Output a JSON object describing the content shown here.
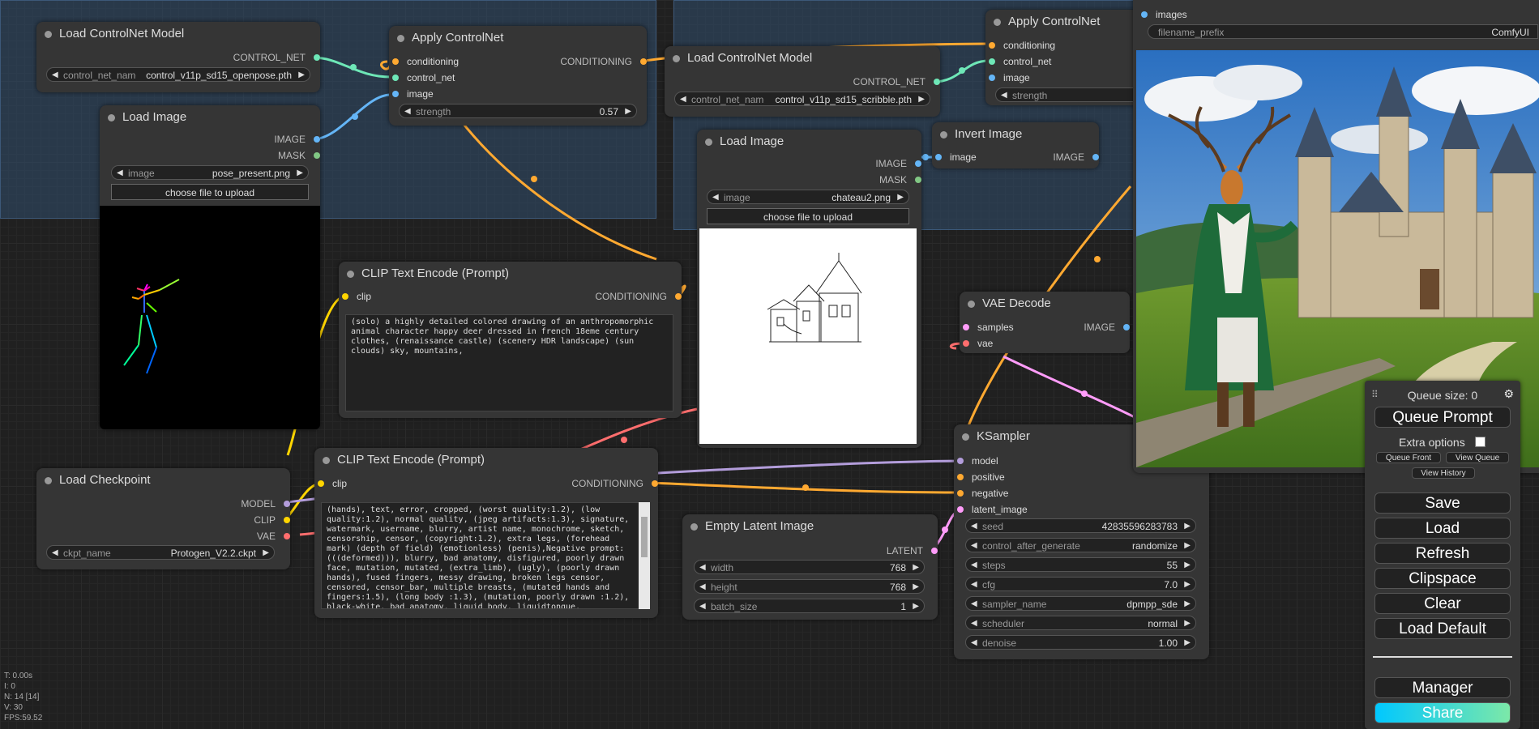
{
  "nodes": {
    "load_cn_1": {
      "title": "Load ControlNet Model",
      "out": "CONTROL_NET",
      "w_name": "control_net_name",
      "w_val": "control_v11p_sd15_openpose.pth"
    },
    "apply_cn_1": {
      "title": "Apply ControlNet",
      "in1": "conditioning",
      "in2": "control_net",
      "in3": "image",
      "out": "CONDITIONING",
      "w_name": "strength",
      "w_val": "0.57"
    },
    "load_image_1": {
      "title": "Load Image",
      "out1": "IMAGE",
      "out2": "MASK",
      "w_name": "image",
      "w_val": "pose_present.png",
      "upload": "choose file to upload"
    },
    "load_cn_2": {
      "title": "Load ControlNet Model",
      "out": "CONTROL_NET",
      "w_name": "control_net_name",
      "w_val": "control_v11p_sd15_scribble.pth"
    },
    "apply_cn_2": {
      "title": "Apply ControlNet",
      "in1": "conditioning",
      "in2": "control_net",
      "in3": "image",
      "w_name": "strength"
    },
    "save_image": {
      "in": "images",
      "w_name": "filename_prefix",
      "w_val": "ComfyUI"
    },
    "load_image_2": {
      "title": "Load Image",
      "out1": "IMAGE",
      "out2": "MASK",
      "w_name": "image",
      "w_val": "chateau2.png",
      "upload": "choose file to upload"
    },
    "invert_image": {
      "title": "Invert Image",
      "in": "image",
      "out": "IMAGE"
    },
    "clip_pos": {
      "title": "CLIP Text Encode (Prompt)",
      "in": "clip",
      "out": "CONDITIONING",
      "text": "(solo) a highly detailed colored drawing of an anthropomorphic animal character happy deer dressed in french 18eme century clothes, (renaissance castle) (scenery HDR landscape) (sun clouds) sky, mountains,"
    },
    "vae_decode": {
      "title": "VAE Decode",
      "in1": "samples",
      "in2": "vae",
      "out": "IMAGE"
    },
    "clip_neg": {
      "title": "CLIP Text Encode (Prompt)",
      "in": "clip",
      "out": "CONDITIONING",
      "text": "(hands), text, error, cropped, (worst quality:1.2), (low quality:1.2), normal quality, (jpeg artifacts:1.3), signature, watermark, username, blurry, artist name, monochrome, sketch, censorship, censor, (copyright:1.2), extra legs, (forehead mark) (depth of field) (emotionless) (penis),Negative prompt: (((deformed))), blurry, bad anatomy, disfigured, poorly drawn face, mutation, mutated, (extra_limb), (ugly), (poorly drawn hands), fused fingers, messy drawing, broken legs censor, censored, censor_bar, multiple breasts, (mutated hands and fingers:1.5), (long body :1.3), (mutation, poorly drawn :1.2), black-white, bad anatomy, liquid body, liquidtongue, disfigured, malformed, mutated, anatomical nonsense,"
    },
    "load_ckpt": {
      "title": "Load Checkpoint",
      "out1": "MODEL",
      "out2": "CLIP",
      "out3": "VAE",
      "w_name": "ckpt_name",
      "w_val": "Protogen_V2.2.ckpt"
    },
    "ksampler": {
      "title": "KSampler",
      "in1": "model",
      "in2": "positive",
      "in3": "negative",
      "in4": "latent_image",
      "widgets": [
        {
          "name": "seed",
          "value": "42835596283783"
        },
        {
          "name": "control_after_generate",
          "value": "randomize"
        },
        {
          "name": "steps",
          "value": "55"
        },
        {
          "name": "cfg",
          "value": "7.0"
        },
        {
          "name": "sampler_name",
          "value": "dpmpp_sde"
        },
        {
          "name": "scheduler",
          "value": "normal"
        },
        {
          "name": "denoise",
          "value": "1.00"
        }
      ]
    },
    "empty_latent": {
      "title": "Empty Latent Image",
      "out": "LATENT",
      "widgets": [
        {
          "name": "width",
          "value": "768"
        },
        {
          "name": "height",
          "value": "768"
        },
        {
          "name": "batch_size",
          "value": "1"
        }
      ]
    }
  },
  "panel": {
    "queue_size": "Queue size: 0",
    "queue_prompt": "Queue Prompt",
    "extra_options": "Extra options",
    "queue_front": "Queue Front",
    "view_queue": "View Queue",
    "view_history": "View History",
    "save": "Save",
    "load": "Load",
    "refresh": "Refresh",
    "clipspace": "Clipspace",
    "clear": "Clear",
    "load_default": "Load Default",
    "manager": "Manager",
    "share": "Share"
  },
  "stats": {
    "t": "T: 0.00s",
    "i": "I: 0",
    "n": "N: 14 [14]",
    "v": "V: 30",
    "fps": "FPS:59.52"
  },
  "colors": {
    "conditioning": "#ffa931",
    "control_net": "#6ee7b7",
    "image": "#64b5f6",
    "clip": "#ffd500",
    "model": "#b39ddb",
    "vae": "#ff6e6e",
    "latent": "#ff9cf9"
  }
}
